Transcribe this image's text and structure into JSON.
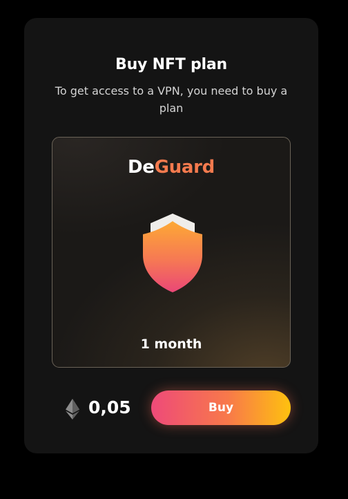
{
  "header": {
    "title": "Buy NFT plan",
    "subtitle": "To get access to a VPN, you need to buy a plan"
  },
  "nft_card": {
    "brand_part1": "De",
    "brand_part2": "Guard",
    "icon": "shield-icon",
    "duration": "1 month"
  },
  "purchase": {
    "currency_icon": "ethereum-icon",
    "price": "0,05",
    "buy_label": "Buy"
  },
  "colors": {
    "background": "#000000",
    "card": "#141414",
    "brand_accent": "#f47a4e",
    "button_gradient_start": "#ee4a79",
    "button_gradient_end": "#fec10f"
  }
}
